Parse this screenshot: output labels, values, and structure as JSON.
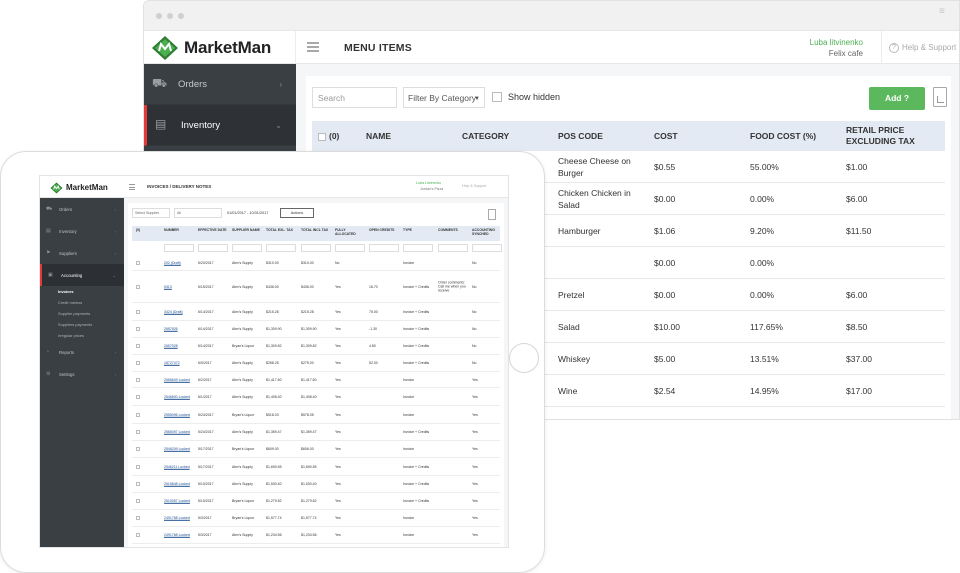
{
  "browser": {
    "brand": "MarketMan",
    "page_title": "MENU ITEMS",
    "user_name": "Luba litvinenko",
    "user_org": "Felix cafe",
    "help_label": "Help & Support",
    "sidebar": [
      {
        "label": "Orders",
        "icon": "orders-icon"
      },
      {
        "label": "Inventory",
        "icon": "inventory-icon",
        "active": true
      }
    ],
    "search_placeholder": "Search",
    "filter_label": "Filter By Category",
    "show_hidden_label": "Show hidden",
    "add_label": "Add",
    "columns": {
      "select": "(0)",
      "name": "NAME",
      "category": "CATEGORY",
      "pos": "POS CODE",
      "cost": "COST",
      "food_cost": "FOOD COST (%)",
      "retail_1": "RETAIL PRICE",
      "retail_2": "EXCLUDING TAX"
    },
    "rows": [
      {
        "pos": "Cheese Cheese on Burger",
        "cost": "$0.55",
        "food_cost": "55.00%",
        "retail": "$1.00"
      },
      {
        "pos": "Chicken Chicken in Salad",
        "cost": "$0.00",
        "food_cost": "0.00%",
        "retail": "$6.00"
      },
      {
        "pos": "Hamburger",
        "cost": "$1.06",
        "food_cost": "9.20%",
        "retail": "$11.50"
      },
      {
        "pos": "",
        "cost": "$0.00",
        "food_cost": "0.00%",
        "retail": ""
      },
      {
        "pos": "Pretzel",
        "cost": "$0.00",
        "food_cost": "0.00%",
        "retail": "$6.00"
      },
      {
        "pos": "Salad",
        "cost": "$10.00",
        "food_cost": "117.65%",
        "retail": "$8.50"
      },
      {
        "pos": "Whiskey",
        "cost": "$5.00",
        "food_cost": "13.51%",
        "retail": "$37.00"
      },
      {
        "pos": "Wine",
        "cost": "$2.54",
        "food_cost": "14.95%",
        "retail": "$17.00"
      }
    ]
  },
  "tablet": {
    "brand": "MarketMan",
    "page_title": "INVOICES / DELIVERY NOTES",
    "user_name": "Luba Litvinenko",
    "user_org": "Jordan's Pizza",
    "help_label": "Help & Support",
    "sidebar": [
      {
        "label": "Orders",
        "icon": "orders-icon"
      },
      {
        "label": "Inventory",
        "icon": "inventory-icon"
      },
      {
        "label": "Suppliers",
        "icon": "suppliers-icon"
      },
      {
        "label": "Accounting",
        "icon": "accounting-icon",
        "active": true
      }
    ],
    "accounting_sub": [
      "Invoices",
      "Credit memos",
      "Supplier payments",
      "Suppliers payments",
      "Irregular prices"
    ],
    "sidebar_bottom": [
      {
        "label": "Reports",
        "icon": "reports-icon"
      },
      {
        "label": "Settings",
        "icon": "settings-icon"
      }
    ],
    "select_supplier": "Select Supplier",
    "all_label": "All",
    "date_range": "01/01/2017 - 10/31/2017",
    "actions_label": "Actions",
    "columns": [
      "(0)",
      "NUMBER",
      "EFFECTIVE DATE",
      "SUPPLIER NAME",
      "TOTAL EXL. TAX",
      "TOTAL INCL TAX",
      "FULLY ALLOCATED",
      "OPEN CREDITS",
      "TYPE",
      "COMMENTS",
      "ACCOUNTING SYNCHED"
    ],
    "rows": [
      {
        "num": "202 (Draft)",
        "date": "6/20/2017",
        "supplier": "Alex's Supply",
        "exl": "$310.00",
        "incl": "$310.00",
        "alloc": "No",
        "credits": "",
        "type": "Invoice",
        "comments": "",
        "sync": "No",
        "h": 15
      },
      {
        "num": "5313",
        "date": "6/15/2017",
        "supplier": "Alex's Supply",
        "exl": "$436.00",
        "incl": "$436.00",
        "alloc": "Yes",
        "credits": "16.70",
        "type": "Invoice + Credits",
        "comments": "Order comments: Call me when you receive",
        "sync": "No",
        "h": 32
      },
      {
        "num": "3424 (Draft)",
        "date": "6/14/2017",
        "supplier": "Alex's Supply",
        "exl": "$215.28",
        "incl": "$215.28",
        "alloc": "Yes",
        "credits": "75.00",
        "type": "Invoice + Credits",
        "comments": "",
        "sync": "No",
        "h": 18
      },
      {
        "num": "2657926",
        "date": "6/14/2017",
        "supplier": "Alex's Supply",
        "exl": "$1,309.90",
        "incl": "$1,309.90",
        "alloc": "Yes",
        "credits": "-1.30",
        "type": "Invoice + Credits",
        "comments": "",
        "sync": "No",
        "h": 17
      },
      {
        "num": "2657928",
        "date": "6/14/2017",
        "supplier": "Bryan's Liquor",
        "exl": "$1,309.82",
        "incl": "$1,309.82",
        "alloc": "Yes",
        "credits": "4.80",
        "type": "Invoice + Credits",
        "comments": "",
        "sync": "No",
        "h": 17
      },
      {
        "num": "18727472",
        "date": "6/9/2017",
        "supplier": "Alex's Supply",
        "exl": "$258.25",
        "incl": "$275.00",
        "alloc": "Yes",
        "credits": "52.00",
        "type": "Invoice + Credits",
        "comments": "",
        "sync": "No",
        "h": 17
      },
      {
        "num": "2556649 Locked",
        "date": "6/2/2017",
        "supplier": "Alex's Supply",
        "exl": "$1,417.60",
        "incl": "$1,417.60",
        "alloc": "Yes",
        "credits": "",
        "type": "Invoice",
        "comments": "",
        "sync": "Yes",
        "h": 16
      },
      {
        "num": "2546600 Locked",
        "date": "6/1/2017",
        "supplier": "Alex's Supply",
        "exl": "$1,408.40",
        "incl": "$1,408.40",
        "alloc": "Yes",
        "credits": "",
        "type": "Invoice",
        "comments": "",
        "sync": "Yes",
        "h": 18
      },
      {
        "num": "2555096 Locked",
        "date": "5/24/2017",
        "supplier": "Bryan's Liquor",
        "exl": "$518.03",
        "incl": "$578.05",
        "alloc": "Yes",
        "credits": "",
        "type": "Invoice",
        "comments": "",
        "sync": "Yes",
        "h": 18
      },
      {
        "num": "2565097 Locked",
        "date": "5/24/2017",
        "supplier": "Alex's Supply",
        "exl": "$1,359.47",
        "incl": "$1,359.47",
        "alloc": "Yes",
        "credits": "",
        "type": "Invoice + Credits",
        "comments": "",
        "sync": "Yes",
        "h": 17
      },
      {
        "num": "2546209 Locked",
        "date": "5/17/2017",
        "supplier": "Bryan's Liquor",
        "exl": "$609.00",
        "incl": "$606.00",
        "alloc": "Yes",
        "credits": "",
        "type": "Invoice",
        "comments": "",
        "sync": "Yes",
        "h": 17
      },
      {
        "num": "2546211 Locked",
        "date": "5/17/2017",
        "supplier": "Alex's Supply",
        "exl": "$1,690.55",
        "incl": "$1,690.55",
        "alloc": "Yes",
        "credits": "",
        "type": "Invoice + Credits",
        "comments": "",
        "sync": "Yes",
        "h": 18
      },
      {
        "num": "2515648 Locked",
        "date": "5/10/2017",
        "supplier": "Alex's Supply",
        "exl": "$1,530.40",
        "incl": "$1,530.40",
        "alloc": "Yes",
        "credits": "",
        "type": "Invoice + Credits",
        "comments": "",
        "sync": "Yes",
        "h": 17
      },
      {
        "num": "2519057 Locked",
        "date": "5/10/2017",
        "supplier": "Bryan's Liquor",
        "exl": "$1,279.82",
        "incl": "$1,279.82",
        "alloc": "Yes",
        "credits": "",
        "type": "Invoice + Credits",
        "comments": "",
        "sync": "Yes",
        "h": 17
      },
      {
        "num": "2491768 Locked",
        "date": "5/3/2017",
        "supplier": "Bryan's Liquor",
        "exl": "$1,577.74",
        "incl": "$1,577.74",
        "alloc": "Yes",
        "credits": "",
        "type": "Invoice",
        "comments": "",
        "sync": "Yes",
        "h": 17
      },
      {
        "num": "2491768 Locked",
        "date": "5/3/2017",
        "supplier": "Alex's Supply",
        "exl": "$1,234.56",
        "incl": "$1,234.56",
        "alloc": "Yes",
        "credits": "",
        "type": "Invoice",
        "comments": "",
        "sync": "Yes",
        "h": 17
      }
    ]
  },
  "colors": {
    "brand_green": "#5cb85c",
    "sidebar": "#3a3f44",
    "header_row": "#e3eaf3",
    "active_accent": "#e53935"
  }
}
